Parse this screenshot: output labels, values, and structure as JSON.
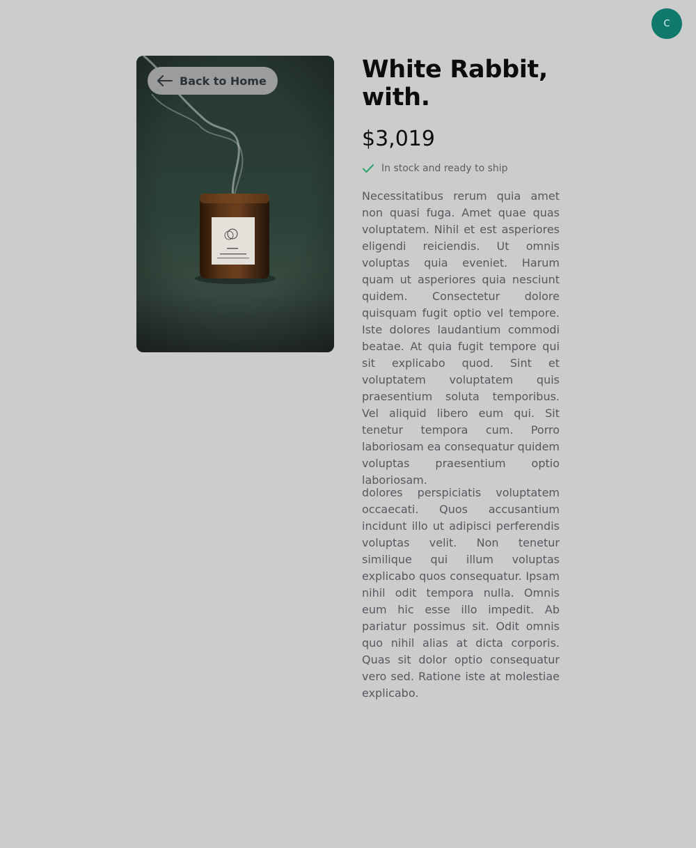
{
  "user": {
    "avatar_initial": "C"
  },
  "nav": {
    "back_label": "Back to Home"
  },
  "product": {
    "title": "White Rabbit, with.",
    "price": "$3,019",
    "stock_status": "In stock and ready to ship",
    "description_1": "Necessitatibus rerum quia amet non quasi fuga. Amet quae quas voluptatem. Nihil et est asperiores eligendi reiciendis. Ut omnis voluptas quia eveniet. Harum quam ut asperiores quia nesciunt quidem. Consectetur dolore quisquam fugit optio vel tempore. Iste dolores laudantium commodi beatae. At quia fugit tempore qui sit explicabo quod. Sint et voluptatem voluptatem quis praesentium soluta temporibus. Vel aliquid libero eum qui. Sit tenetur tempora cum. Porro laboriosam ea consequatur quidem voluptas praesentium optio laboriosam.",
    "description_2": "dolores perspiciatis voluptatem occaecati. Quos accusantium incidunt illo ut adipisci perferendis voluptas velit. Non tenetur similique qui illum voluptas explicabo quos consequatur. Ipsam nihil odit tempora nulla. Omnis eum hic esse illo impedit. Ab pariatur possimus sit. Odit omnis quo nihil alias at dicta corporis. Quas sit dolor optio consequatur vero sed. Ratione iste at molestiae explicabo."
  },
  "icons": {
    "back": "arrow-left-icon",
    "stock": "check-icon",
    "product_image": "candle-photo"
  },
  "colors": {
    "background": "#cccccc",
    "avatar": "#0f7a6c",
    "check": "#2fa36b",
    "title": "#0c0c0c",
    "body_text": "#55595e"
  }
}
